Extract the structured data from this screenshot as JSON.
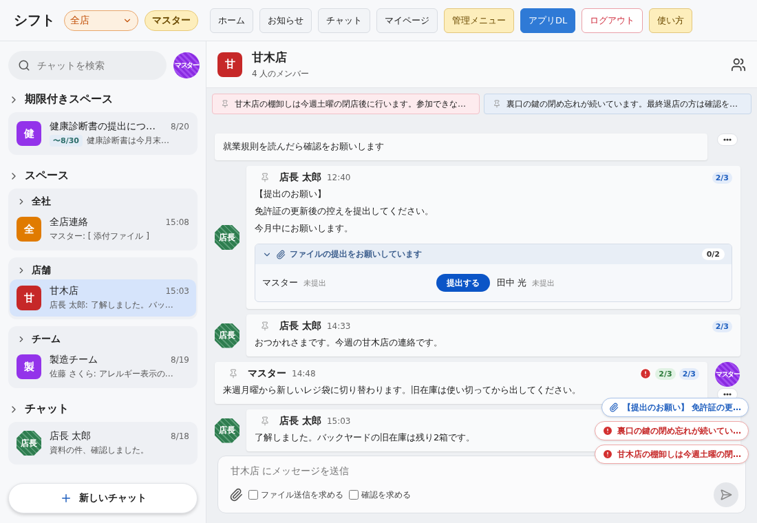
{
  "app_title": "シフト",
  "store_select": {
    "value": "全店"
  },
  "role_badge": "マスター",
  "nav": [
    {
      "label": "ホーム",
      "kind": "plain"
    },
    {
      "label": "お知らせ",
      "kind": "plain"
    },
    {
      "label": "チャット",
      "kind": "plain"
    },
    {
      "label": "マイページ",
      "kind": "plain"
    },
    {
      "label": "管理メニュー",
      "kind": "warn"
    },
    {
      "label": "アプリDL",
      "kind": "primary"
    },
    {
      "label": "ログアウト",
      "kind": "danger"
    },
    {
      "label": "使い方",
      "kind": "warn"
    }
  ],
  "sidebar": {
    "search": {
      "placeholder": "チャットを検索"
    },
    "user_avatar": "マスター",
    "sections": [
      {
        "title": "期限付きスペース",
        "groups": [
          {
            "items": [
              {
                "avatar": "健",
                "color": "#9333ea",
                "kind": "space",
                "name": "健康診断書の提出につ…",
                "time": "8/20",
                "deadline": "〜8/30",
                "preview": "健康診断書は今月末…",
                "selected": false
              }
            ]
          }
        ]
      },
      {
        "title": "スペース",
        "groups": [
          {
            "title": "全社",
            "items": [
              {
                "avatar": "全",
                "color": "#e07b00",
                "kind": "space",
                "name": "全店連絡",
                "time": "15:08",
                "preview": "マスター: [ 添付ファイル ]",
                "selected": false
              }
            ]
          },
          {
            "title": "店舗",
            "items": [
              {
                "avatar": "甘",
                "color": "#c62828",
                "kind": "space",
                "name": "甘木店",
                "time": "15:03",
                "preview": "店長 太郎: 了解しました。バッ…",
                "selected": true
              }
            ]
          },
          {
            "title": "チーム",
            "items": [
              {
                "avatar": "製",
                "color": "#9333ea",
                "kind": "space",
                "name": "製造チーム",
                "time": "8/19",
                "preview": "佐藤 さくら: アレルギー表示の…",
                "selected": false
              }
            ]
          }
        ]
      },
      {
        "title": "チャット",
        "groups": [
          {
            "items": [
              {
                "avatar": "店長",
                "color": "#2e7d4f",
                "kind": "person",
                "name": "店長 太郎",
                "time": "8/18",
                "preview": "資料の件、確認しました。",
                "selected": false
              }
            ]
          }
        ]
      }
    ],
    "new_chat": "新しいチャット"
  },
  "room": {
    "avatar": "甘",
    "color": "#c62828",
    "name": "甘木店",
    "members": "4 人のメンバー"
  },
  "pins": [
    {
      "kind": "alert",
      "text": "甘木店の棚卸しは今週土曜の閉店後に行います。参加できな…"
    },
    {
      "kind": "info",
      "text": "裏口の鍵の閉め忘れが続いています。最終退店の方は確認を…"
    }
  ],
  "messages": [
    {
      "outgoing": true,
      "lines": [
        "就業規則を読んだら確認をお願いします"
      ]
    },
    {
      "outgoing": false,
      "avatar": "店長",
      "author": "店長 太郎",
      "time": "12:40",
      "badges": [
        {
          "kind": "read",
          "text": "2/3"
        }
      ],
      "lines": [
        "【提出のお願い】",
        "免許証の更新後の控えを提出してください。",
        "今月中にお願いします。"
      ],
      "file_request": {
        "title": "ファイルの提出をお願いしています",
        "count": "0/2",
        "expanded": true,
        "entries": [
          {
            "name": "マスター",
            "status": "未提出",
            "action": "提出する"
          },
          {
            "name": "田中 光",
            "status": "未提出"
          }
        ]
      }
    },
    {
      "outgoing": false,
      "avatar": "店長",
      "author": "店長 太郎",
      "time": "14:33",
      "badges": [
        {
          "kind": "read",
          "text": "2/3"
        }
      ],
      "lines": [
        "おつかれさまです。今週の甘木店の連絡です。"
      ]
    },
    {
      "outgoing": true,
      "avatar": "マスター",
      "author": "マスター",
      "time": "14:48",
      "badges": [
        {
          "kind": "alert"
        },
        {
          "kind": "confirm",
          "text": "2/3"
        },
        {
          "kind": "read",
          "text": "2/3"
        }
      ],
      "lines": [
        "来週月曜から新しいレジ袋に切り替わります。旧在庫は使い切ってから出してください。"
      ]
    },
    {
      "outgoing": false,
      "avatar": "店長",
      "author": "店長 太郎",
      "time": "15:03",
      "lines": [
        "了解しました。バックヤードの旧在庫は残り2箱です。"
      ]
    }
  ],
  "floating_chips": [
    {
      "kind": "file",
      "text": "【提出のお願い】 免許証の更…"
    },
    {
      "kind": "alert",
      "text": "裏口の鍵の閉め忘れが続いてい…"
    },
    {
      "kind": "alert",
      "text": "甘木店の棚卸しは今週土曜の閉…"
    }
  ],
  "composer": {
    "placeholder": "甘木店 にメッセージを送信",
    "options": [
      {
        "label": "ファイル送信を求める",
        "checked": false
      },
      {
        "label": "確認を求める",
        "checked": false
      }
    ]
  }
}
